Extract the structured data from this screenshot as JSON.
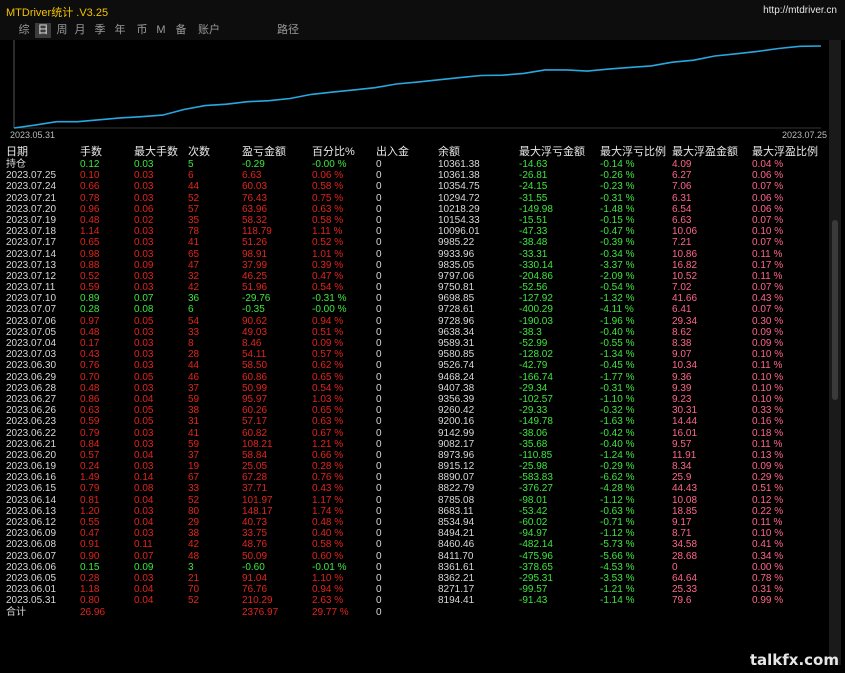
{
  "window": {
    "title": "MTDriver统计 .V3.25",
    "url": "http://mtdriver.cn"
  },
  "tabs": [
    {
      "label": "综",
      "active": false
    },
    {
      "label": "日",
      "active": true
    },
    {
      "label": "周",
      "active": false
    },
    {
      "label": "月",
      "active": false
    },
    {
      "label": "季",
      "active": false
    },
    {
      "label": "年",
      "active": false
    },
    {
      "label": "币",
      "active": false
    },
    {
      "label": "M",
      "active": false
    },
    {
      "label": "备",
      "active": false
    },
    {
      "label": "账户",
      "active": false
    },
    {
      "label": "路径",
      "active": false
    }
  ],
  "chart_data": {
    "type": "line",
    "x_start_label": "2023.05.31",
    "x_end_label": "2023.07.25",
    "series": [
      {
        "values": [
          8194.41,
          8271.17,
          8362.21,
          8361.61,
          8411.7,
          8460.46,
          8494.21,
          8534.94,
          8683.11,
          8785.08,
          8822.79,
          8890.07,
          8915.12,
          8973.96,
          9082.17,
          9142.99,
          9200.16,
          9260.42,
          9356.39,
          9407.38,
          9468.24,
          9526.74,
          9580.85,
          9589.31,
          9638.34,
          9728.96,
          9728.61,
          9698.85,
          9750.81,
          9797.06,
          9835.05,
          9933.96,
          9985.22,
          10096.01,
          10154.33,
          10218.29,
          10294.72,
          10354.75,
          10361.38
        ]
      }
    ],
    "color": "#29a8e0"
  },
  "table": {
    "headers": [
      "日期",
      "手数",
      "最大手数",
      "次数",
      "盈亏金额",
      "百分比%",
      "出入金",
      "余额",
      "最大浮亏金额",
      "最大浮亏比例",
      "最大浮盈金额",
      "最大浮盈比例"
    ],
    "rows": [
      [
        "持仓",
        "0.12",
        "0.03",
        "5",
        "-0.29",
        "-0.00 %",
        "0",
        "10361.38",
        "-14.63",
        "-0.14 %",
        "4.09",
        "0.04 %"
      ],
      [
        "2023.07.25",
        "0.10",
        "0.03",
        "6",
        "6.63",
        "0.06 %",
        "0",
        "10361.38",
        "-26.81",
        "-0.26 %",
        "6.27",
        "0.06 %"
      ],
      [
        "2023.07.24",
        "0.66",
        "0.03",
        "44",
        "60.03",
        "0.58 %",
        "0",
        "10354.75",
        "-24.15",
        "-0.23 %",
        "7.06",
        "0.07 %"
      ],
      [
        "2023.07.21",
        "0.78",
        "0.03",
        "52",
        "76.43",
        "0.75 %",
        "0",
        "10294.72",
        "-31.55",
        "-0.31 %",
        "6.31",
        "0.06 %"
      ],
      [
        "2023.07.20",
        "0.96",
        "0.06",
        "57",
        "63.96",
        "0.63 %",
        "0",
        "10218.29",
        "-149.98",
        "-1.48 %",
        "6.54",
        "0.06 %"
      ],
      [
        "2023.07.19",
        "0.48",
        "0.02",
        "35",
        "58.32",
        "0.58 %",
        "0",
        "10154.33",
        "-15.51",
        "-0.15 %",
        "6.63",
        "0.07 %"
      ],
      [
        "2023.07.18",
        "1.14",
        "0.03",
        "78",
        "118.79",
        "1.11 %",
        "0",
        "10096.01",
        "-47.33",
        "-0.47 %",
        "10.06",
        "0.10 %"
      ],
      [
        "2023.07.17",
        "0.65",
        "0.03",
        "41",
        "51.26",
        "0.52 %",
        "0",
        "9985.22",
        "-38.48",
        "-0.39 %",
        "7.21",
        "0.07 %"
      ],
      [
        "2023.07.14",
        "0.98",
        "0.03",
        "65",
        "98.91",
        "1.01 %",
        "0",
        "9933.96",
        "-33.31",
        "-0.34 %",
        "10.86",
        "0.11 %"
      ],
      [
        "2023.07.13",
        "0.88",
        "0.09",
        "47",
        "37.99",
        "0.39 %",
        "0",
        "9835.05",
        "-330.14",
        "-3.37 %",
        "16.82",
        "0.17 %"
      ],
      [
        "2023.07.12",
        "0.52",
        "0.03",
        "32",
        "46.25",
        "0.47 %",
        "0",
        "9797.06",
        "-204.86",
        "-2.09 %",
        "10.52",
        "0.11 %"
      ],
      [
        "2023.07.11",
        "0.59",
        "0.03",
        "42",
        "51.96",
        "0.54 %",
        "0",
        "9750.81",
        "-52.56",
        "-0.54 %",
        "7.02",
        "0.07 %"
      ],
      [
        "2023.07.10",
        "0.89",
        "0.07",
        "36",
        "-29.76",
        "-0.31 %",
        "0",
        "9698.85",
        "-127.92",
        "-1.32 %",
        "41.66",
        "0.43 %"
      ],
      [
        "2023.07.07",
        "0.28",
        "0.08",
        "6",
        "-0.35",
        "-0.00 %",
        "0",
        "9728.61",
        "-400.29",
        "-4.11 %",
        "6.41",
        "0.07 %"
      ],
      [
        "2023.07.06",
        "0.97",
        "0.05",
        "54",
        "90.62",
        "0.94 %",
        "0",
        "9728.96",
        "-190.03",
        "-1.96 %",
        "29.34",
        "0.30 %"
      ],
      [
        "2023.07.05",
        "0.48",
        "0.03",
        "33",
        "49.03",
        "0.51 %",
        "0",
        "9638.34",
        "-38.3",
        "-0.40 %",
        "8.62",
        "0.09 %"
      ],
      [
        "2023.07.04",
        "0.17",
        "0.03",
        "8",
        "8.46",
        "0.09 %",
        "0",
        "9589.31",
        "-52.99",
        "-0.55 %",
        "8.38",
        "0.09 %"
      ],
      [
        "2023.07.03",
        "0.43",
        "0.03",
        "28",
        "54.11",
        "0.57 %",
        "0",
        "9580.85",
        "-128.02",
        "-1.34 %",
        "9.07",
        "0.10 %"
      ],
      [
        "2023.06.30",
        "0.76",
        "0.03",
        "44",
        "58.50",
        "0.62 %",
        "0",
        "9526.74",
        "-42.79",
        "-0.45 %",
        "10.34",
        "0.11 %"
      ],
      [
        "2023.06.29",
        "0.70",
        "0.05",
        "46",
        "60.86",
        "0.65 %",
        "0",
        "9468.24",
        "-166.74",
        "-1.77 %",
        "9.36",
        "0.10 %"
      ],
      [
        "2023.06.28",
        "0.48",
        "0.03",
        "37",
        "50.99",
        "0.54 %",
        "0",
        "9407.38",
        "-29.34",
        "-0.31 %",
        "9.39",
        "0.10 %"
      ],
      [
        "2023.06.27",
        "0.86",
        "0.04",
        "59",
        "95.97",
        "1.03 %",
        "0",
        "9356.39",
        "-102.57",
        "-1.10 %",
        "9.23",
        "0.10 %"
      ],
      [
        "2023.06.26",
        "0.63",
        "0.05",
        "38",
        "60.26",
        "0.65 %",
        "0",
        "9260.42",
        "-29.33",
        "-0.32 %",
        "30.31",
        "0.33 %"
      ],
      [
        "2023.06.23",
        "0.59",
        "0.05",
        "31",
        "57.17",
        "0.63 %",
        "0",
        "9200.16",
        "-149.78",
        "-1.63 %",
        "14.44",
        "0.16 %"
      ],
      [
        "2023.06.22",
        "0.79",
        "0.03",
        "41",
        "60.82",
        "0.67 %",
        "0",
        "9142.99",
        "-38.06",
        "-0.42 %",
        "16.01",
        "0.18 %"
      ],
      [
        "2023.06.21",
        "0.84",
        "0.03",
        "59",
        "108.21",
        "1.21 %",
        "0",
        "9082.17",
        "-35.68",
        "-0.40 %",
        "9.57",
        "0.11 %"
      ],
      [
        "2023.06.20",
        "0.57",
        "0.04",
        "37",
        "58.84",
        "0.66 %",
        "0",
        "8973.96",
        "-110.85",
        "-1.24 %",
        "11.91",
        "0.13 %"
      ],
      [
        "2023.06.19",
        "0.24",
        "0.03",
        "19",
        "25.05",
        "0.28 %",
        "0",
        "8915.12",
        "-25.98",
        "-0.29 %",
        "8.34",
        "0.09 %"
      ],
      [
        "2023.06.16",
        "1.49",
        "0.14",
        "67",
        "67.28",
        "0.76 %",
        "0",
        "8890.07",
        "-583.83",
        "-6.62 %",
        "25.9",
        "0.29 %"
      ],
      [
        "2023.06.15",
        "0.79",
        "0.08",
        "33",
        "37.71",
        "0.43 %",
        "0",
        "8822.79",
        "-376.27",
        "-4.28 %",
        "44.43",
        "0.51 %"
      ],
      [
        "2023.06.14",
        "0.81",
        "0.04",
        "52",
        "101.97",
        "1.17 %",
        "0",
        "8785.08",
        "-98.01",
        "-1.12 %",
        "10.08",
        "0.12 %"
      ],
      [
        "2023.06.13",
        "1.20",
        "0.03",
        "80",
        "148.17",
        "1.74 %",
        "0",
        "8683.11",
        "-53.42",
        "-0.63 %",
        "18.85",
        "0.22 %"
      ],
      [
        "2023.06.12",
        "0.55",
        "0.04",
        "29",
        "40.73",
        "0.48 %",
        "0",
        "8534.94",
        "-60.02",
        "-0.71 %",
        "9.17",
        "0.11 %"
      ],
      [
        "2023.06.09",
        "0.47",
        "0.03",
        "38",
        "33.75",
        "0.40 %",
        "0",
        "8494.21",
        "-94.97",
        "-1.12 %",
        "8.71",
        "0.10 %"
      ],
      [
        "2023.06.08",
        "0.91",
        "0.11",
        "42",
        "48.76",
        "0.58 %",
        "0",
        "8460.46",
        "-482.14",
        "-5.73 %",
        "34.58",
        "0.41 %"
      ],
      [
        "2023.06.07",
        "0.90",
        "0.07",
        "48",
        "50.09",
        "0.60 %",
        "0",
        "8411.70",
        "-475.96",
        "-5.66 %",
        "28.68",
        "0.34 %"
      ],
      [
        "2023.06.06",
        "0.15",
        "0.09",
        "3",
        "-0.60",
        "-0.01 %",
        "0",
        "8361.61",
        "-378.65",
        "-4.53 %",
        "0",
        "0.00 %"
      ],
      [
        "2023.06.05",
        "0.28",
        "0.03",
        "21",
        "91.04",
        "1.10 %",
        "0",
        "8362.21",
        "-295.31",
        "-3.53 %",
        "64.64",
        "0.78 %"
      ],
      [
        "2023.06.01",
        "1.18",
        "0.04",
        "70",
        "76.76",
        "0.94 %",
        "0",
        "8271.17",
        "-99.57",
        "-1.21 %",
        "25.33",
        "0.31 %"
      ],
      [
        "2023.05.31",
        "0.80",
        "0.04",
        "52",
        "210.29",
        "2.63 %",
        "0",
        "8194.41",
        "-91.43",
        "-1.14 %",
        "79.6",
        "0.99 %"
      ]
    ],
    "total": [
      "合计",
      "26.96",
      "",
      "",
      "2376.97",
      "29.77 %",
      "0",
      "",
      "",
      "",
      "",
      ""
    ]
  },
  "colors": {
    "red": "#e2241d",
    "green": "#3ee63e",
    "white": "#d8d8d8",
    "pink": "#ff6688"
  },
  "watermark": "talkfx.com"
}
